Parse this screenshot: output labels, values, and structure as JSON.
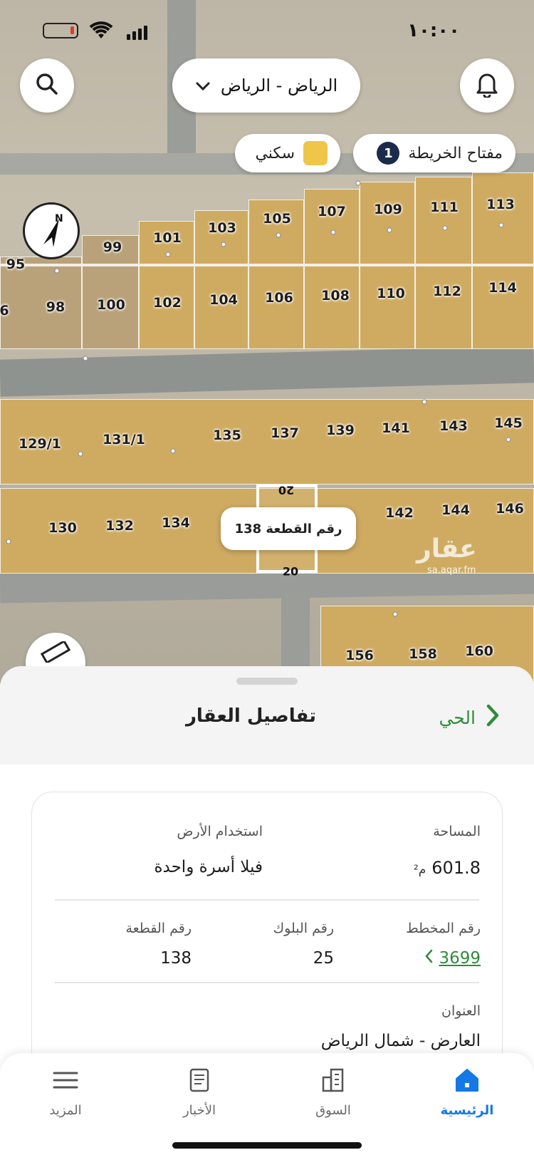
{
  "status_bar": {
    "time": "١٠:٠٠"
  },
  "header": {
    "city_selector": "الرياض - الرياض"
  },
  "map_key": {
    "label": "مفتاح الخريطة",
    "count": "1",
    "legend_label": "سكني",
    "legend_color": "#efc64a"
  },
  "map": {
    "plots": [
      "113",
      "111",
      "109",
      "107",
      "105",
      "103",
      "101",
      "99",
      "95",
      "114",
      "112",
      "110",
      "108",
      "106",
      "104",
      "102",
      "100",
      "98",
      "6",
      "145",
      "143",
      "141",
      "139",
      "137",
      "135",
      "131/1",
      "129/1",
      "146",
      "144",
      "142",
      "134",
      "132",
      "130",
      "156",
      "158",
      "160"
    ],
    "selected_plot_dims": {
      "top": "20",
      "bottom": "20"
    },
    "tooltip": "رقم القطعة 138",
    "watermark": "عقار",
    "watermark_sub": "sa.aqar.fm"
  },
  "sheet": {
    "title": "تفاصيل العقار",
    "district_link": "الحي",
    "area_label": "المساحة",
    "area_value": "601.8",
    "area_unit": "م²",
    "land_use_label": "استخدام الأرض",
    "land_use_value": "فيلا أسرة واحدة",
    "plan_label": "رقم المخطط",
    "plan_value": "3699",
    "block_label": "رقم البلوك",
    "block_value": "25",
    "plot_label": "رقم القطعة",
    "plot_value": "138",
    "address_label": "العنوان",
    "address_value": "العارض - شمال الرياض"
  },
  "nav": {
    "home": "الرئيسية",
    "market": "السوق",
    "news": "الأخبار",
    "more": "المزيد",
    "active_color": "#1479e6"
  },
  "colors": {
    "accent_green": "#2e8c3a",
    "plot_fill": "#cfab62"
  }
}
